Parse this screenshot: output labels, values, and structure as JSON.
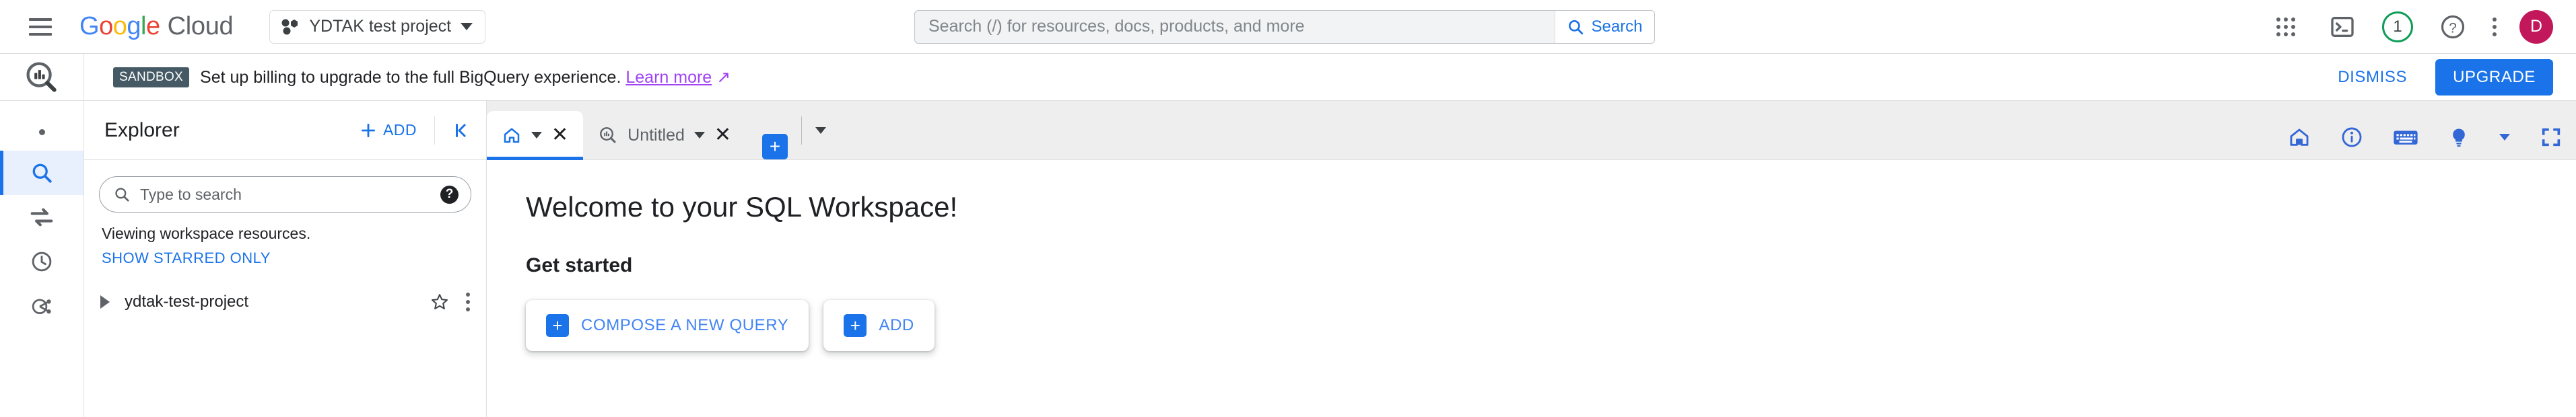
{
  "header": {
    "menu_icon": "hamburger-menu-icon",
    "logo": {
      "google": "Google",
      "cloud": "Cloud"
    },
    "project_selector": {
      "label": "YDTAK test project",
      "icon": "project-dots-icon"
    },
    "search": {
      "placeholder": "Search (/) for resources, docs, products, and more",
      "value": "",
      "button_label": "Search",
      "icon": "search-icon"
    },
    "icons": {
      "apps": "apps-grid-icon",
      "cloud_shell": "cloud-shell-terminal-icon",
      "notifications_count": "1",
      "help": "help-question-icon",
      "more": "more-vertical-icon"
    },
    "avatar_initial": "D"
  },
  "banner": {
    "badge": "SANDBOX",
    "message": "Set up billing to upgrade to the full BigQuery experience.",
    "link_label": "Learn more",
    "link_icon": "external-link-icon",
    "dismiss_label": "DISMISS",
    "upgrade_label": "UPGRADE"
  },
  "rail": {
    "product_icon": "bigquery-logo-icon",
    "items": [
      {
        "name": "dot-marker",
        "icon": "dot-icon",
        "active": false
      },
      {
        "name": "search",
        "icon": "search-icon",
        "active": true
      },
      {
        "name": "data-transfers",
        "icon": "transfer-arrows-icon",
        "active": false
      },
      {
        "name": "scheduled-queries",
        "icon": "clock-icon",
        "active": false
      },
      {
        "name": "analytics-hub",
        "icon": "pipeline-share-icon",
        "active": false
      }
    ]
  },
  "explorer": {
    "title": "Explorer",
    "add_label": "ADD",
    "add_icon": "plus-icon",
    "collapse_icon": "collapse-panel-icon",
    "search": {
      "placeholder": "Type to search",
      "value": "",
      "icon": "search-icon",
      "help_icon": "help-icon"
    },
    "viewing_note": "Viewing workspace resources.",
    "starred_link": "SHOW STARRED ONLY",
    "tree": [
      {
        "label": "ydtak-test-project",
        "expand_icon": "triangle-right-icon",
        "star_icon": "star-outline-icon",
        "menu_icon": "more-vertical-icon"
      }
    ]
  },
  "tabs": {
    "items": [
      {
        "name": "home",
        "label": "",
        "icon": "home-icon",
        "active": true,
        "has_caret": true,
        "has_close": true
      },
      {
        "name": "untitled-query",
        "label": "Untitled",
        "icon": "bigquery-query-icon",
        "active": false,
        "has_caret": true,
        "has_close": true
      }
    ],
    "new_tab_icon": "plus-icon",
    "new_tab_caret": "chevron-down-icon",
    "right_icons": [
      "home-icon",
      "info-icon",
      "keyboard-shortcuts-icon",
      "lightbulb-tips-icon",
      "chevron-down-icon",
      "fullscreen-icon"
    ]
  },
  "content": {
    "welcome_title": "Welcome to your SQL Workspace!",
    "get_started_title": "Get started",
    "cards": [
      {
        "label": "COMPOSE A NEW QUERY",
        "icon": "plus-icon"
      },
      {
        "label": "ADD",
        "icon": "plus-icon"
      }
    ]
  },
  "colors": {
    "accent_blue": "#1a73e8",
    "link_blue": "#4285f4",
    "visited_purple": "#a142f4",
    "green_ring": "#0f9d58",
    "avatar_pink": "#c2185b",
    "sandbox_slate": "#455a64"
  }
}
